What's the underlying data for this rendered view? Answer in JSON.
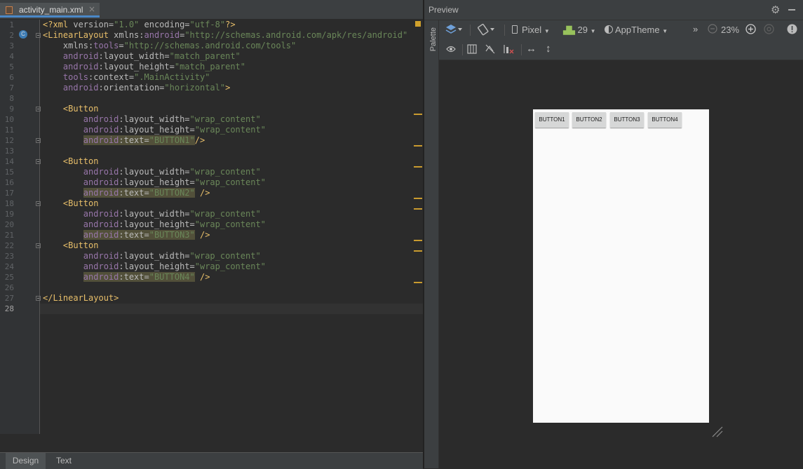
{
  "editor": {
    "tab_label": "activity_main.xml",
    "tab_close": "×",
    "current_line": 28,
    "gutter_badge": "C",
    "lines": [
      [
        [
          "tg",
          "<?xml"
        ],
        [
          "at",
          " version="
        ],
        [
          "vl",
          "\"1.0\""
        ],
        [
          "at",
          " encoding="
        ],
        [
          "vl",
          "\"utf-8\""
        ],
        [
          "tg",
          "?>"
        ]
      ],
      [
        [
          "tg",
          "<LinearLayout"
        ],
        [
          "at",
          " xmlns:"
        ],
        [
          "ns",
          "android"
        ],
        [
          "at",
          "="
        ],
        [
          "vl",
          "\"http://schemas.android.com/apk/res/android\""
        ]
      ],
      [
        [
          "at",
          "    xmlns:"
        ],
        [
          "ns",
          "tools"
        ],
        [
          "at",
          "="
        ],
        [
          "vl",
          "\"http://schemas.android.com/tools\""
        ]
      ],
      [
        [
          "ns",
          "    android"
        ],
        [
          "at",
          ":layout_width="
        ],
        [
          "vl",
          "\"match_parent\""
        ]
      ],
      [
        [
          "ns",
          "    android"
        ],
        [
          "at",
          ":layout_height="
        ],
        [
          "vl",
          "\"match_parent\""
        ]
      ],
      [
        [
          "ns",
          "    tools"
        ],
        [
          "at",
          ":context="
        ],
        [
          "vl",
          "\".MainActivity\""
        ]
      ],
      [
        [
          "ns",
          "    android"
        ],
        [
          "at",
          ":orientation="
        ],
        [
          "vl",
          "\"horizontal\""
        ],
        [
          "tg",
          ">"
        ]
      ],
      [],
      [
        [
          "tg",
          "    <Button"
        ]
      ],
      [
        [
          "ns",
          "        android"
        ],
        [
          "at",
          ":layout_width="
        ],
        [
          "vl",
          "\"wrap_content\""
        ]
      ],
      [
        [
          "ns",
          "        android"
        ],
        [
          "at",
          ":layout_height="
        ],
        [
          "vl",
          "\"wrap_content\""
        ]
      ],
      [
        [
          "at",
          "        "
        ],
        [
          "nsh",
          "android"
        ],
        [
          "ath",
          ":text="
        ],
        [
          "vlh",
          "\"BUTTON1\""
        ],
        [
          "tg",
          "/>"
        ]
      ],
      [],
      [
        [
          "tg",
          "    <Button"
        ]
      ],
      [
        [
          "ns",
          "        android"
        ],
        [
          "at",
          ":layout_width="
        ],
        [
          "vl",
          "\"wrap_content\""
        ]
      ],
      [
        [
          "ns",
          "        android"
        ],
        [
          "at",
          ":layout_height="
        ],
        [
          "vl",
          "\"wrap_content\""
        ]
      ],
      [
        [
          "at",
          "        "
        ],
        [
          "nsh",
          "android"
        ],
        [
          "ath",
          ":text="
        ],
        [
          "vlh",
          "\"BUTTON2\""
        ],
        [
          "tg",
          " />"
        ]
      ],
      [
        [
          "tg",
          "    <Button"
        ]
      ],
      [
        [
          "ns",
          "        android"
        ],
        [
          "at",
          ":layout_width="
        ],
        [
          "vl",
          "\"wrap_content\""
        ]
      ],
      [
        [
          "ns",
          "        android"
        ],
        [
          "at",
          ":layout_height="
        ],
        [
          "vl",
          "\"wrap_content\""
        ]
      ],
      [
        [
          "at",
          "        "
        ],
        [
          "nsh",
          "android"
        ],
        [
          "ath",
          ":text="
        ],
        [
          "vlh",
          "\"BUTTON3\""
        ],
        [
          "tg",
          " />"
        ]
      ],
      [
        [
          "tg",
          "    <Button"
        ]
      ],
      [
        [
          "ns",
          "        android"
        ],
        [
          "at",
          ":layout_width="
        ],
        [
          "vl",
          "\"wrap_content\""
        ]
      ],
      [
        [
          "ns",
          "        android"
        ],
        [
          "at",
          ":layout_height="
        ],
        [
          "vl",
          "\"wrap_content\""
        ]
      ],
      [
        [
          "at",
          "        "
        ],
        [
          "nsh",
          "android"
        ],
        [
          "ath",
          ":text="
        ],
        [
          "vlh",
          "\"BUTTON4\""
        ],
        [
          "tg",
          " />"
        ]
      ],
      [],
      [
        [
          "tg",
          "</LinearLayout>"
        ]
      ],
      []
    ]
  },
  "bottom_tabs": {
    "design": "Design",
    "text": "Text"
  },
  "preview": {
    "title": "Preview",
    "palette_label": "Palette",
    "toolbar": {
      "device": "Pixel",
      "api_level": "29",
      "theme": "AppTheme",
      "overflow": "»",
      "zoom": "23%"
    },
    "buttons": [
      "BUTTON1",
      "BUTTON2",
      "BUTTON3",
      "BUTTON4"
    ]
  },
  "icons": [
    "file-xml-icon",
    "class-icon",
    "gear-icon",
    "minimize-icon",
    "layers-icon",
    "orientation-icon",
    "device-icon",
    "android-icon",
    "theme-icon",
    "zoom-out-icon",
    "zoom-in-icon",
    "zoom-reset-icon",
    "warning-icon",
    "eye-icon",
    "blueprint-icon",
    "hide-constraints-icon",
    "margins-icon",
    "horizontal-resize-icon",
    "vertical-resize-icon",
    "resize-handle-icon"
  ],
  "colors": {
    "tag": "#e8bf6a",
    "namespace": "#9876aa",
    "attribute": "#bababa",
    "value": "#6a8759",
    "highlight": "#52503a",
    "accent": "#4a88c7",
    "marker": "#c99b2f"
  }
}
